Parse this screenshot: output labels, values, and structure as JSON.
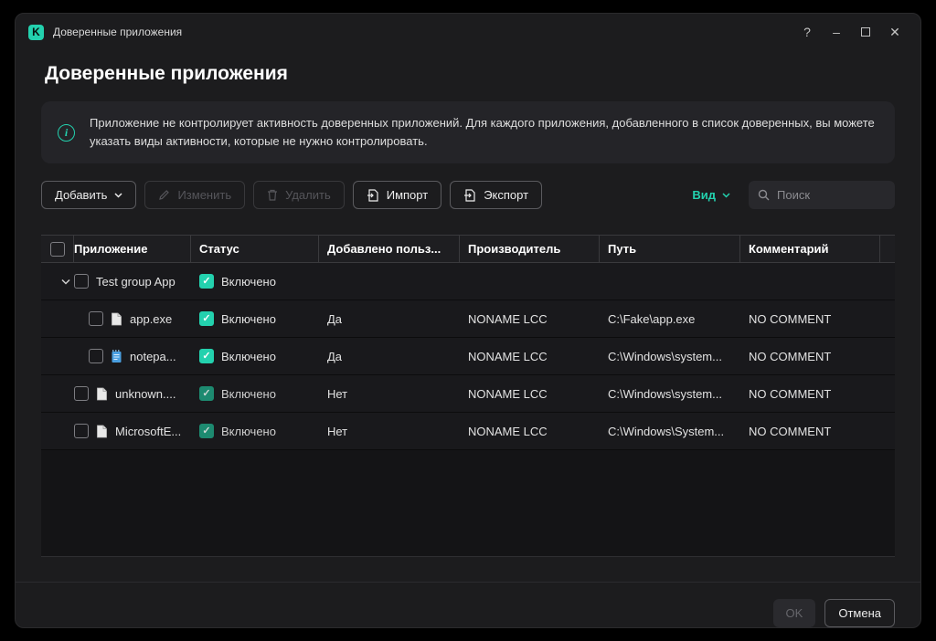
{
  "window": {
    "title": "Доверенные приложения",
    "controls": {
      "help": "?",
      "minimize": "–",
      "close": "✕"
    }
  },
  "page": {
    "heading": "Доверенные приложения",
    "info_text": "Приложение не контролирует активность доверенных приложений. Для каждого приложения, добавленного в список доверенных, вы можете указать виды активности, которые не нужно контролировать."
  },
  "toolbar": {
    "add_label": "Добавить",
    "edit_label": "Изменить",
    "delete_label": "Удалить",
    "import_label": "Импорт",
    "export_label": "Экспорт",
    "view_label": "Вид",
    "search_placeholder": "Поиск"
  },
  "table": {
    "columns": [
      "Приложение",
      "Статус",
      "Добавлено польз...",
      "Производитель",
      "Путь",
      "Комментарий"
    ],
    "group": {
      "name": "Test group App",
      "status": "Включено"
    },
    "rows": [
      {
        "name": "app.exe",
        "status": "Включено",
        "added": "Да",
        "vendor": "NONAME LCC",
        "path": "C:\\Fake\\app.exe",
        "comment": "NO COMMENT"
      },
      {
        "name": "notepa...",
        "status": "Включено",
        "added": "Да",
        "vendor": "NONAME LCC",
        "path": "C:\\Windows\\system...",
        "comment": "NO COMMENT"
      },
      {
        "name": "unknown....",
        "status": "Включено",
        "added": "Нет",
        "vendor": "NONAME LCC",
        "path": "C:\\Windows\\system...",
        "comment": "NO COMMENT"
      },
      {
        "name": "MicrosoftE...",
        "status": "Включено",
        "added": "Нет",
        "vendor": "NONAME LCC",
        "path": "C:\\Windows\\System...",
        "comment": "NO COMMENT"
      }
    ]
  },
  "footer": {
    "ok_label": "OK",
    "cancel_label": "Отмена"
  },
  "colors": {
    "accent": "#23d1ae"
  }
}
